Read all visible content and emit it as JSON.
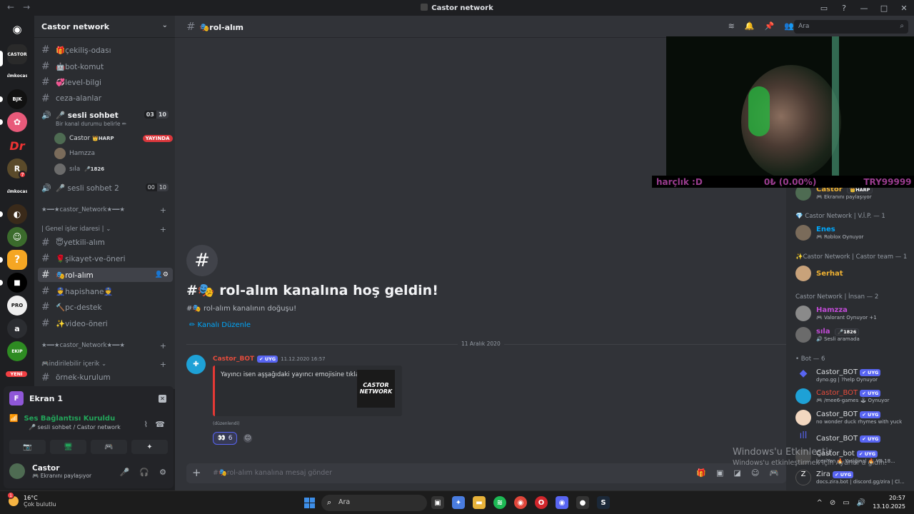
{
  "window": {
    "title": "Castor network",
    "back": "←",
    "forward": "→"
  },
  "rail": {
    "servers": [
      {
        "name": "Discord",
        "label": "◉"
      },
      {
        "name": "CASTOR",
        "label": "CASTOR"
      },
      {
        "name": "Almkocası",
        "label": "Almkocası"
      },
      {
        "name": "Beşiktaş",
        "label": "BJK"
      },
      {
        "name": "Flower",
        "label": "✿"
      },
      {
        "name": "Dr",
        "label": "Dr"
      },
      {
        "name": "Rockstar",
        "label": "R",
        "badge": "7"
      },
      {
        "name": "Almkocası2",
        "label": "Almkocası"
      },
      {
        "name": "Cartoon",
        "label": "◐"
      },
      {
        "name": "Frog",
        "label": "☺"
      },
      {
        "name": "Yellow",
        "label": "?"
      },
      {
        "name": "Black",
        "label": "■"
      },
      {
        "name": "ProPublic",
        "label": "PRO"
      },
      {
        "name": "A",
        "label": "a"
      },
      {
        "name": "Green",
        "label": "EKIP"
      }
    ],
    "new_label": "YENİ"
  },
  "sidebar": {
    "server_name": "Castor network",
    "channels": [
      {
        "name": "🎁çekiliş-odası"
      },
      {
        "name": "🤖bot-komut"
      },
      {
        "name": "💞level-bilgi"
      },
      {
        "name": "ceza-alanlar"
      }
    ],
    "voice1": {
      "name": "sesli sohbet",
      "status": "Bir kanal durumu belirle ✏",
      "count": "03",
      "limit": "10"
    },
    "voice_users": [
      {
        "name": "Castor",
        "tag": "👑HARP",
        "live": "YAYINDA"
      },
      {
        "name": "Hamzza"
      },
      {
        "name": "sıla",
        "tag": "🎤1826"
      }
    ],
    "voice2": {
      "name": "sesli sohbet 2",
      "count": "00",
      "limit": "10"
    },
    "cat1": "★━━★castor_Network★━━★",
    "cat2": "| Genel işler idaresi | ⌄",
    "channels2": [
      {
        "name": "😇yetkili-alım"
      },
      {
        "name": "🌹şikayet-ve-öneri"
      },
      {
        "name": "🎭rol-alım"
      },
      {
        "name": "👮hapishane👮"
      },
      {
        "name": "🔨pc-destek"
      },
      {
        "name": "✨video-öneri"
      }
    ],
    "cat3": "★━━★castor_Network★━━★",
    "cat4": "🎮indirilebilir içerik ⌄",
    "channels3": [
      {
        "name": "örnek-kurulum"
      }
    ]
  },
  "panel": {
    "screen_title": "Ekran 1",
    "screen_letter": "F",
    "voice_connected": "Ses Bağlantısı Kuruldu",
    "voice_location": "🎤 sesli sohbet / Castor network",
    "user": "Castor",
    "user_status": "🎮 Ekranını paylaşıyor"
  },
  "main": {
    "channel": "🎭rol-alım",
    "search_placeholder": "Ara",
    "welcome_title": "#🎭 rol-alım kanalına hoş geldin!",
    "welcome_sub": "#🎭 rol-alım kanalının doğuşu!",
    "edit_channel": "✏ Kanalı Düzenle",
    "date_divider": "11 Aralık 2020",
    "message": {
      "author": "Castor_BOT",
      "badge": "✔ UYG",
      "time": "11.12.2020 16:57",
      "embed_text": "Yayıncı isen aşşağıdaki yayıncı emojisine tıkla.",
      "thumb_text": "CASTOR NETWORK",
      "edited": "(düzenlendi)",
      "reaction_emoji": "👀",
      "reaction_count": "6"
    },
    "composer_placeholder": "#🎭rol-alım kanalına mesaj gönder"
  },
  "stream": {
    "ticker_text": "harçlık :D",
    "ticker_amount": "0₺ (0.00%)",
    "ticker_end": "TRY99999"
  },
  "members": {
    "groups": [
      {
        "title": "Castor Network | V.İ.P. — 1"
      },
      {
        "title": "✨Castor Network | Castor team — 1"
      },
      {
        "title": "Castor Network | İnsan — 2"
      },
      {
        "title": "• Bot — 6"
      }
    ],
    "list": [
      {
        "name": "Castor",
        "tag": "👑HARP",
        "activity": "🎮 Ekranını paylaşıyor",
        "color": "#f0b232"
      },
      {
        "name": "Enes",
        "activity": "🎮 Roblox Oynuyor",
        "color": "#00a8fc"
      },
      {
        "name": "Serhat",
        "activity": "",
        "color": "#f0b232"
      },
      {
        "name": "Hamzza",
        "activity": "🎮 Valorant Oynuyor +1",
        "color": "#c14bd6"
      },
      {
        "name": "sıla",
        "tag": "🎤1826",
        "activity": "🔊 Sesli aramada",
        "color": "#c14bd6"
      },
      {
        "name": "Castor_BOT",
        "badge": "✔ UYG",
        "activity": "dyno.gg | ?help Oynuyor",
        "color": "#dbdee1"
      },
      {
        "name": "Castor_BOT",
        "badge": "✔ UYG",
        "activity": "🎮 /mee6-games 🕹 Oynuyor",
        "color": "#e74c3c"
      },
      {
        "name": "Castor_BOT",
        "badge": "✔ UYG",
        "activity": "no wonder duck rhymes with yuck",
        "color": "#dbdee1"
      },
      {
        "name": "Castor_BOT",
        "badge": "✔ UYG",
        "activity": "",
        "color": "#dbdee1"
      },
      {
        "name": "Castor_bot",
        "badge": "✔ UYG",
        "activity": "İçeriYen 🔥 Yasiğinal 🔥 V8.18...",
        "color": "#dbdee1"
      },
      {
        "name": "Zira",
        "badge": "✔ UYG",
        "activity": "docs.zira.bot | discord.gg/zira | Cl...",
        "color": "#dbdee1"
      }
    ]
  },
  "watermark": {
    "line1": "Windows'u Etkinleştir",
    "line2": "Windows'u etkinleştirmek için Ayarlar'a gidin."
  },
  "taskbar": {
    "temp": "16°C",
    "weather": "Çok bulutlu",
    "weather_badge": "1",
    "search": "Ara",
    "time": "20:57",
    "date": "13.10.2025"
  }
}
